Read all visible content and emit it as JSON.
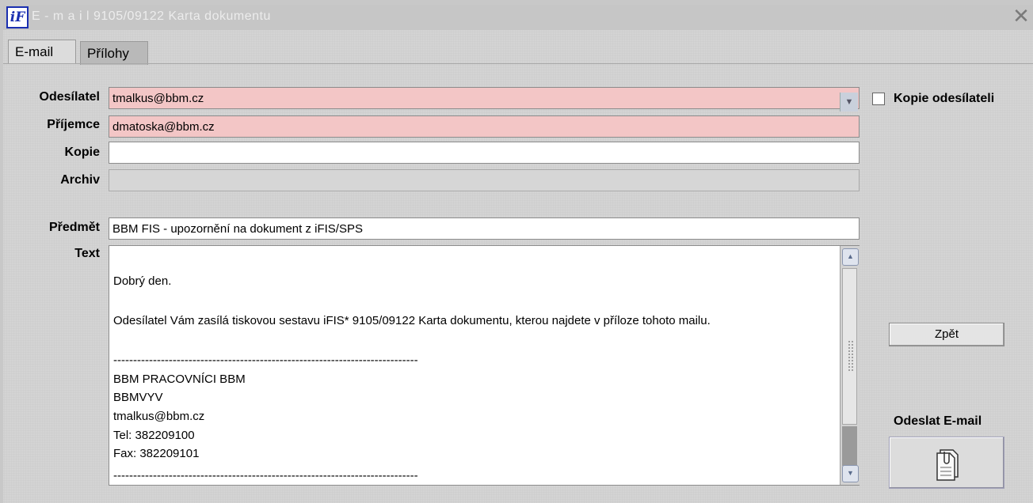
{
  "window": {
    "logo_text": "iF",
    "title": "E - m a i l   9105/09122 Karta dokumentu",
    "close_glyph": "✕"
  },
  "tabs": [
    {
      "label": "E-mail",
      "active": true
    },
    {
      "label": "Přílohy",
      "active": false
    }
  ],
  "form": {
    "sender_label": "Odesílatel",
    "sender_value": "tmalkus@bbm.cz",
    "recipient_label": "Příjemce",
    "recipient_value": "dmatoska@bbm.cz",
    "copy_label": "Kopie",
    "copy_value": "",
    "archive_label": "Archiv",
    "archive_value": "",
    "subject_label": "Předmět",
    "subject_value": "BBM FIS - upozornění na dokument z iFIS/SPS",
    "text_label": "Text",
    "text_lines": [
      "Dobrý den.",
      "Odesílatel Vám zasílá tiskovou sestavu iFIS* 9105/09122 Karta dokumentu, kterou najdete v příloze tohoto mailu.",
      "-----------------------------------------------------------------------------",
      "BBM PRACOVNÍCI BBM",
      "BBMVYV",
      "tmalkus@bbm.cz",
      "Tel: 382209100",
      "Fax: 382209101",
      "-----------------------------------------------------------------------------"
    ]
  },
  "copy_sender": {
    "label": "Kopie odesílateli",
    "checked": false
  },
  "buttons": {
    "back_label": "Zpět",
    "send_label": "Odeslat E-mail"
  },
  "icons": {
    "dropdown": "chevron-down-icon",
    "send": "document-icon",
    "scroll_up": "arrow-up-icon",
    "scroll_down": "arrow-down-icon"
  },
  "colors": {
    "required_field": "#f3c6c6",
    "logo_blue": "#1a2fb0"
  }
}
